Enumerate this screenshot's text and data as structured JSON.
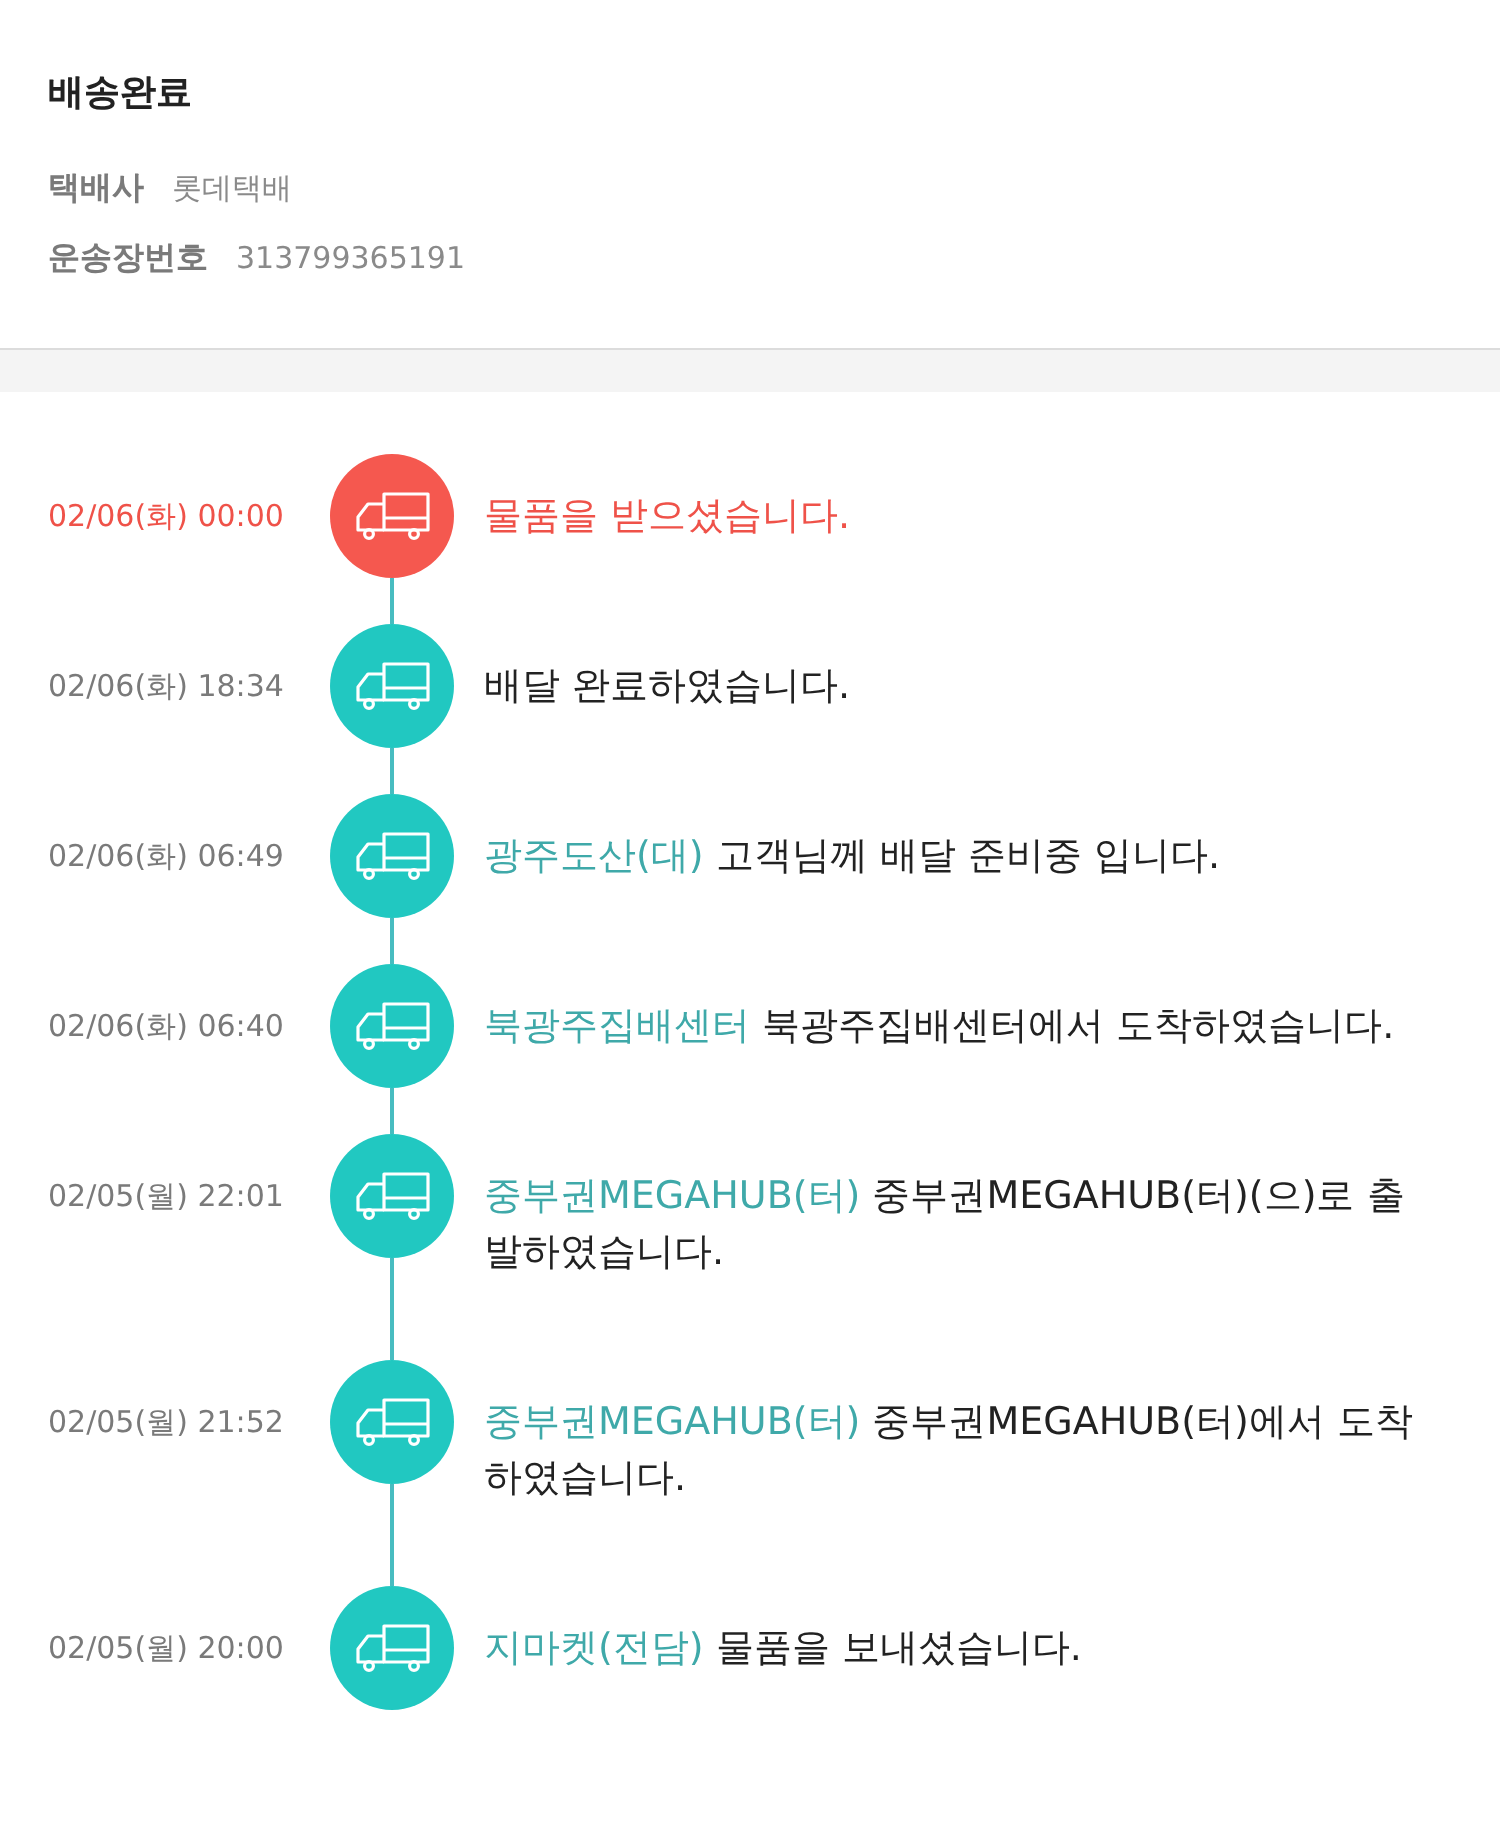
{
  "header": {
    "status": "배송완료",
    "details": [
      {
        "label": "택배사",
        "value": "롯데택배"
      },
      {
        "label": "운송장번호",
        "value": "313799365191"
      }
    ]
  },
  "events": [
    {
      "time": "02/06(화) 00:00",
      "highlighted": true,
      "message": "물품을 받으셨습니다."
    },
    {
      "time": "02/06(화) 18:34",
      "highlighted": false,
      "message": "배달 완료하였습니다."
    },
    {
      "time": "02/06(화) 06:49",
      "highlighted": false,
      "location": "광주도산(대)",
      "message": "고객님께 배달 준비중 입니다."
    },
    {
      "time": "02/06(화) 06:40",
      "highlighted": false,
      "location": "북광주집배센터",
      "message": "북광주집배센터에서 도착하였습니다."
    },
    {
      "time": "02/05(월) 22:01",
      "highlighted": false,
      "location": "중부권MEGAHUB(터)",
      "message": "중부권MEGAHUB(터)(으)로 출발하였습니다."
    },
    {
      "time": "02/05(월) 21:52",
      "highlighted": false,
      "location": "중부권MEGAHUB(터)",
      "message": "중부권MEGAHUB(터)에서 도착하였습니다."
    },
    {
      "time": "02/05(월) 20:00",
      "highlighted": false,
      "location": "지마켓(전담)",
      "message": "물품을 보내셨습니다."
    }
  ]
}
